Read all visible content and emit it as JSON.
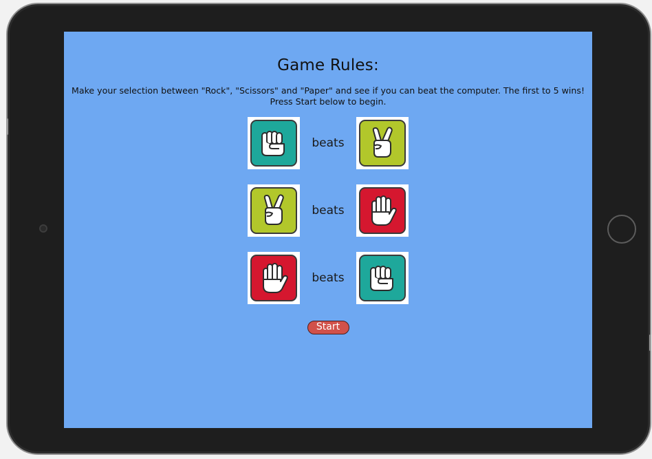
{
  "rules_screen": {
    "title": "Game Rules:",
    "intro": "Make your selection between \"Rock\", \"Scissors\" and \"Paper\" and see if you can beat the computer. The first to 5 wins! Press Start below to begin.",
    "rules": [
      {
        "winner": "rock",
        "verb": "beats",
        "loser": "scissors"
      },
      {
        "winner": "scissors",
        "verb": "beats",
        "loser": "paper"
      },
      {
        "winner": "paper",
        "verb": "beats",
        "loser": "rock"
      }
    ],
    "start_label": "Start"
  },
  "icons": {
    "rock": "rock-hand-icon",
    "scissors": "scissors-hand-icon",
    "paper": "paper-hand-icon"
  },
  "colors": {
    "screen_background": "#6ea8f2",
    "rock": "#1ea89b",
    "scissors": "#b2c72b",
    "paper": "#d5172f",
    "start_button": "#d1514a"
  }
}
